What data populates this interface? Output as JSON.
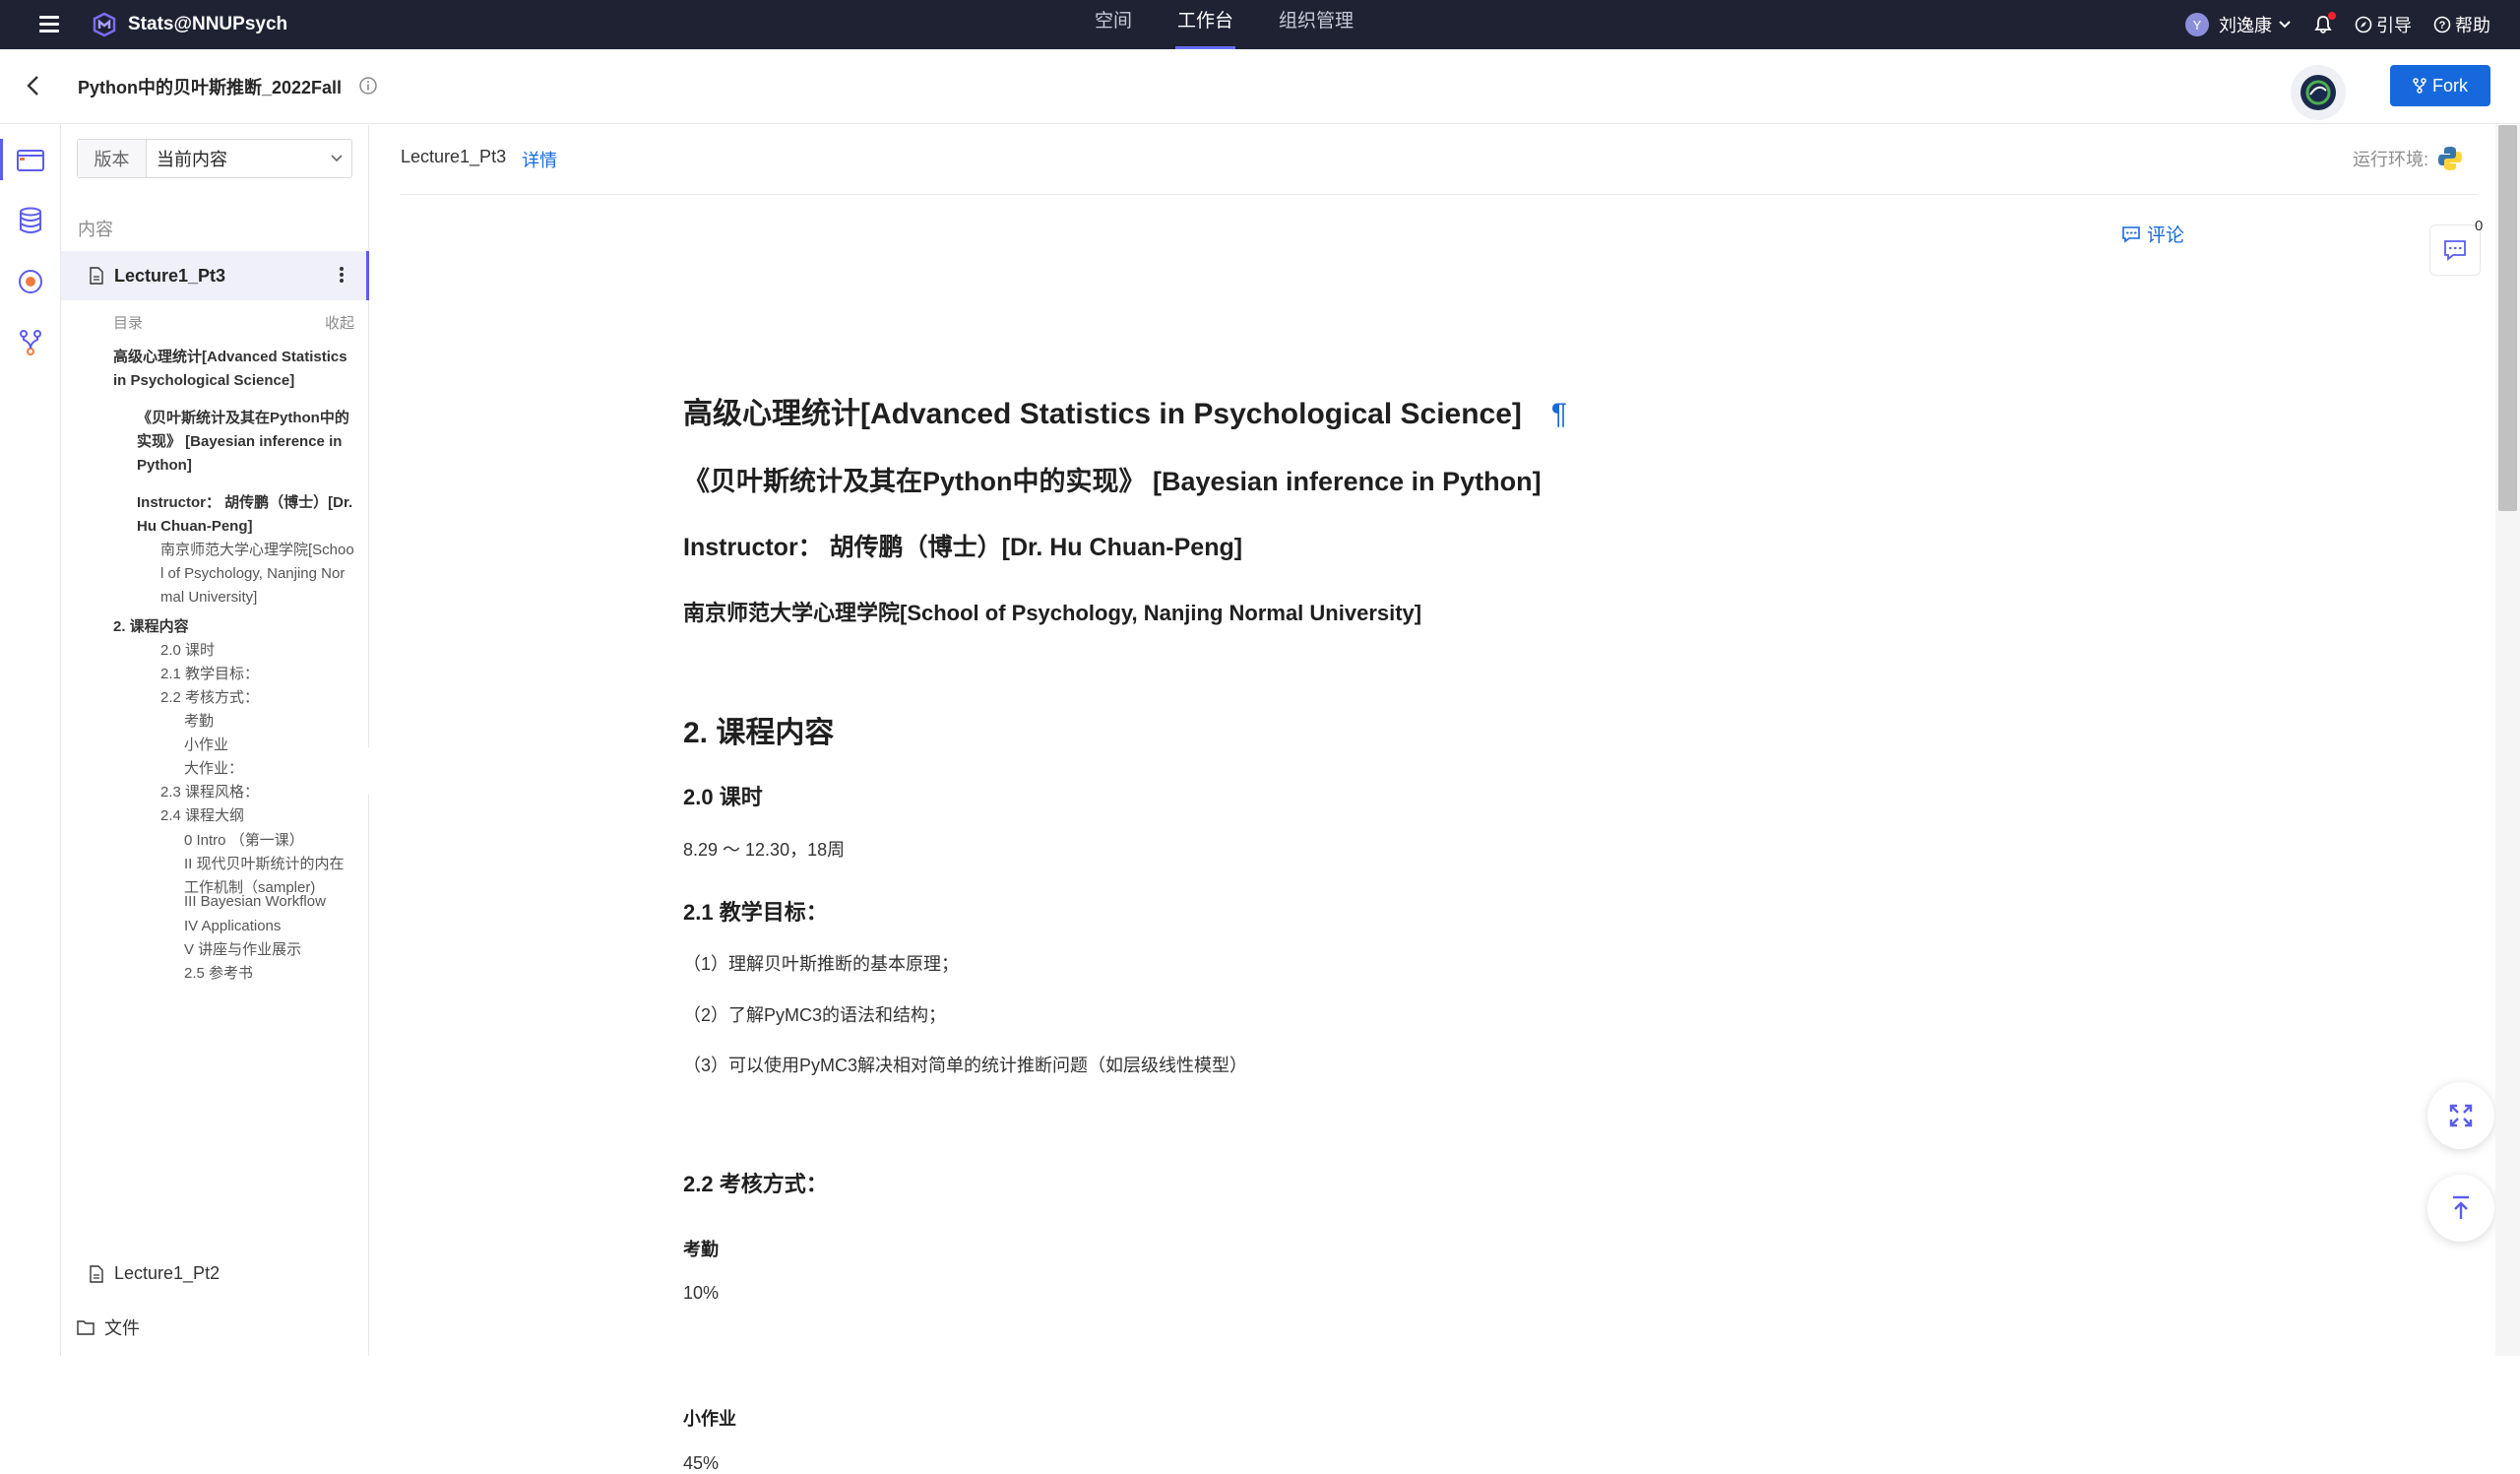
{
  "topbar": {
    "app_title": "Stats@NNUPsych",
    "nav": [
      {
        "label": "空间",
        "active": false
      },
      {
        "label": "工作台",
        "active": true
      },
      {
        "label": "组织管理",
        "active": false
      }
    ],
    "user": {
      "initial": "Y",
      "name": "刘逸康"
    },
    "guide_label": "引导",
    "help_label": "帮助"
  },
  "subbar": {
    "project_title": "Python中的贝叶斯推断_2022Fall",
    "fork_label": "Fork"
  },
  "sidebar": {
    "version_label": "版本",
    "version_value": "当前内容",
    "content_label": "内容",
    "active_file": "Lecture1_Pt3",
    "toc_label": "目录",
    "toc_collapse": "收起",
    "toc": [
      {
        "text": "高级心理统计[Advanced Statistics in Psychological Science]",
        "level": 1,
        "bold": true
      },
      {
        "text": "《贝叶斯统计及其在Python中的实现》 [Bayesian inference in Python]",
        "level": 2,
        "bold": true
      },
      {
        "text": "Instructor： 胡传鹏（博士）[Dr. Hu Chuan-Peng]",
        "level": 2,
        "bold": true
      },
      {
        "text": "南京师范大学心理学院[School of Psychology, Nanjing Normal University]",
        "level": 3,
        "bold": false
      },
      {
        "text": "2. 课程内容",
        "level": 1,
        "bold": true
      },
      {
        "text": "2.0 课时",
        "level": 3,
        "bold": false
      },
      {
        "text": "2.1 教学目标：",
        "level": 3,
        "bold": false
      },
      {
        "text": "2.2 考核方式：",
        "level": 3,
        "bold": false
      },
      {
        "text": "考勤",
        "level": 4,
        "bold": false
      },
      {
        "text": "小作业",
        "level": 4,
        "bold": false
      },
      {
        "text": "大作业：",
        "level": 4,
        "bold": false
      },
      {
        "text": "2.3 课程风格：",
        "level": 3,
        "bold": false
      },
      {
        "text": "2.4 课程大纲",
        "level": 3,
        "bold": false
      },
      {
        "text": "0 Intro （第一课）",
        "level": 4,
        "bold": false
      },
      {
        "text": "II 现代贝叶斯统计的内在工作机制（sampler)",
        "level": 4,
        "bold": false
      },
      {
        "text": "III Bayesian Workflow",
        "level": 4,
        "bold": false
      },
      {
        "text": "IV Applications",
        "level": 4,
        "bold": false
      },
      {
        "text": "V 讲座与作业展示",
        "level": 4,
        "bold": false
      },
      {
        "text": "2.5 参考书",
        "level": 4,
        "bold": false
      }
    ],
    "other_file": "Lecture1_Pt2",
    "folder": "文件"
  },
  "main": {
    "crumb_file": "Lecture1_Pt3",
    "crumb_detail": "详情",
    "runtime_label": "运行环境:",
    "comment_label": "评论",
    "comment_count": "0",
    "doc": {
      "title": "高级心理统计[Advanced Statistics in Psychological Science]",
      "pilcrow": "¶",
      "subtitle": "《贝叶斯统计及其在Python中的实现》 [Bayesian inference in Python]",
      "instructor": "Instructor： 胡传鹏（博士）[Dr. Hu Chuan-Peng]",
      "school": "南京师范大学心理学院[School of Psychology, Nanjing Normal University]",
      "section2": "2. 课程内容",
      "s20": "2.0 课时",
      "s20_text": "8.29 ～ 12.30，18周",
      "s21": "2.1 教学目标：",
      "goal1": "（1）理解贝叶斯推断的基本原理；",
      "goal2": "（2）了解PyMC3的语法和结构；",
      "goal3": "（3）可以使用PyMC3解决相对简单的统计推断问题（如层级线性模型）",
      "s22": "2.2 考核方式：",
      "attendance": "考勤",
      "attendance_pct": "10%",
      "homework": "小作业",
      "homework_pct": "45%"
    }
  },
  "colors": {
    "topbar": "#1f2233",
    "accent": "#5b5cf0",
    "link": "#1668dc"
  }
}
